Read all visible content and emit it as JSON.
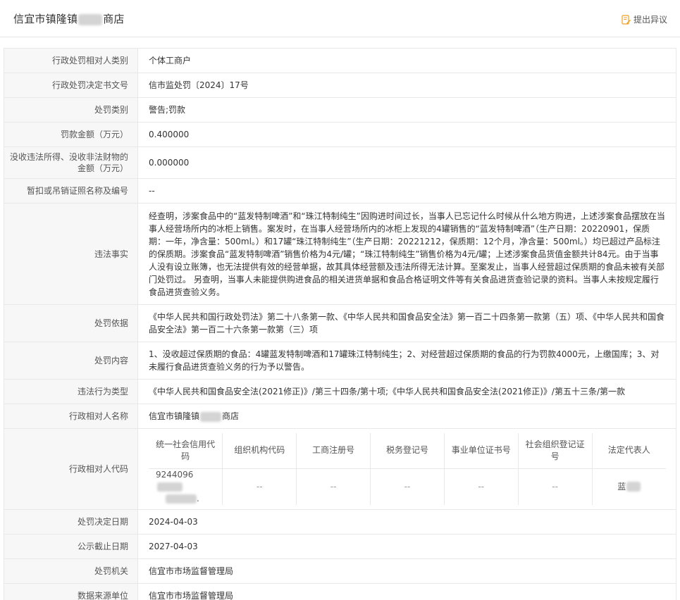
{
  "header": {
    "title_prefix": "信宜市镇隆镇",
    "title_suffix": "商店",
    "action_label": "提出异议"
  },
  "rows": {
    "subject_type": {
      "label": "行政处罚相对人类别",
      "value": "个体工商户"
    },
    "decision_no": {
      "label": "行政处罚决定书文号",
      "value": "信市监处罚〔2024〕17号"
    },
    "penalty_type": {
      "label": "处罚类别",
      "value": "警告;罚款"
    },
    "fine_amount": {
      "label": "罚款金额（万元）",
      "value": "0.400000"
    },
    "confiscation": {
      "label": "没收违法所得、没收非法财物的金额（万元）",
      "value": "0.000000"
    },
    "license": {
      "label": "暂扣或吊销证照名称及编号",
      "value": "--"
    },
    "facts": {
      "label": "违法事实",
      "value": "经查明，涉案食品中的“蓝发特制啤酒”和“珠江特制纯生”因购进时间过长，当事人已忘记什么时候从什么地方购进，上述涉案食品摆放在当事人经营场所内的冰柜上销售。案发时，在当事人经营场所内的冰柜上发现的4罐销售的“蓝发特制啤酒”（生产日期：20220901，保质期：一年，净含量：500ml。）和17罐“珠江特制纯生”（生产日期：20221212，保质期：12个月，净含量：500ml。）均已超过产品标注的保质期。涉案食品“蓝发特制啤酒”销售价格为4元/罐；“珠江特制纯生”销售价格为4元/罐；上述涉案食品货值金额共计84元。由于当事人没有设立账簿，也无法提供有效的经营单据，故其具体经营额及违法所得无法计算。至案发止，当事人经营超过保质期的食品未被有关部门处罚过。 另查明，当事人未能提供购进食品的相关进货单据和食品合格证明文件等有关食品进货查验记录的资料。当事人未按规定履行食品进货查验义务。"
    },
    "basis": {
      "label": "处罚依据",
      "value": "《中华人民共和国行政处罚法》第二十八条第一款、《中华人民共和国食品安全法》第一百二十四条第一款第（五）项、《中华人民共和国食品安全法》第一百二十六条第一款第（三）项"
    },
    "content": {
      "label": "处罚内容",
      "value": "1、没收超过保质期的食品：4罐蓝发特制啤酒和17罐珠江特制纯生；2、对经营超过保质期的食品的行为罚款4000元，上缴国库；3、对未履行食品进货查验义务的行为予以警告。"
    },
    "violation_type": {
      "label": "违法行为类型",
      "value": "《中华人民共和国食品安全法(2021修正)》/第三十四条/第十项;《中华人民共和国食品安全法(2021修正)》/第五十三条/第一款"
    },
    "subject_name": {
      "label": "行政相对人名称",
      "value_prefix": "信宜市镇隆镇",
      "value_suffix": "商店"
    },
    "subject_code": {
      "label": "行政相对人代码",
      "headers": [
        "统一社会信用代码",
        "组织机构代码",
        "工商注册号",
        "税务登记号",
        "事业单位证书号",
        "社会组织登记证号",
        "法定代表人"
      ],
      "values": {
        "credit_code_prefix": "9244096",
        "credit_code_tail": ".",
        "org_code": "--",
        "biz_reg": "--",
        "tax_reg": "--",
        "inst_cert": "--",
        "social_org": "--",
        "legal_rep": "蓝"
      }
    },
    "decision_date": {
      "label": "处罚决定日期",
      "value": "2024-04-03"
    },
    "publish_end": {
      "label": "公示截止日期",
      "value": "2027-04-03"
    },
    "authority": {
      "label": "处罚机关",
      "value": "信宜市市场监督管理局"
    },
    "data_source": {
      "label": "数据来源单位",
      "value": "信宜市市场监督管理局"
    }
  }
}
